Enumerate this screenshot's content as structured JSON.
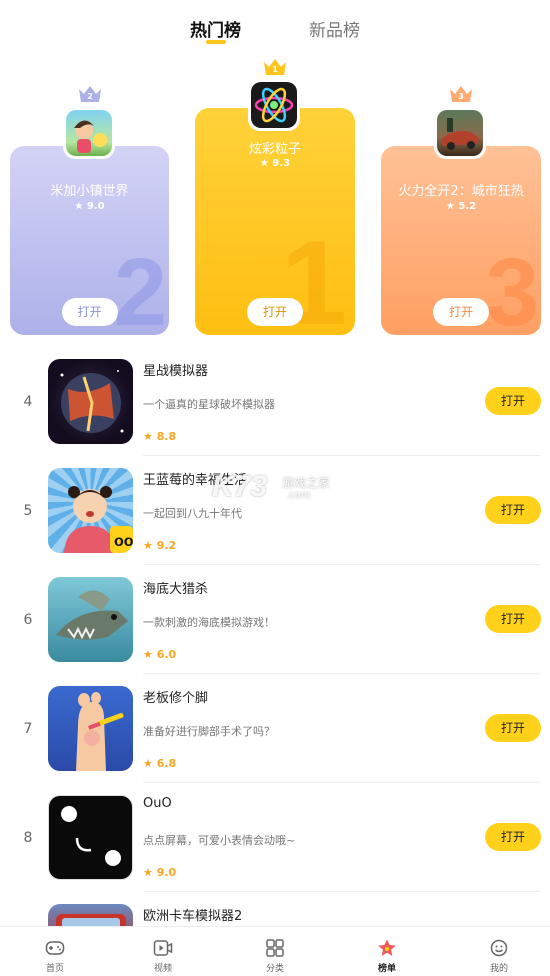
{
  "tabs": [
    {
      "label": "热门榜",
      "active": true
    },
    {
      "label": "新品榜",
      "active": false
    }
  ],
  "podium": [
    {
      "rank": "1",
      "name": "炫彩粒子",
      "rating": "9.3",
      "button": "打开",
      "color": "#ffc51a"
    },
    {
      "rank": "2",
      "name": "米加小镇世界",
      "rating": "9.0",
      "button": "打开",
      "color": "#aeb1e9"
    },
    {
      "rank": "3",
      "name": "火力全开2：城市狂热",
      "rating": "5.2",
      "button": "打开",
      "color": "#ff9f62"
    }
  ],
  "list": [
    {
      "rank": "4",
      "name": "星战模拟器",
      "desc": "一个逼真的星球破坏模拟器",
      "rating": "8.8",
      "button": "打开"
    },
    {
      "rank": "5",
      "name": "王蓝莓的幸福生活",
      "desc": "一起回到八九十年代",
      "rating": "9.2",
      "button": "打开"
    },
    {
      "rank": "6",
      "name": "海底大猎杀",
      "desc": "一款刺激的海底模拟游戏！",
      "rating": "6.0",
      "button": "打开"
    },
    {
      "rank": "7",
      "name": "老板修个脚",
      "desc": "准备好进行脚部手术了吗？",
      "rating": "6.8",
      "button": "打开"
    },
    {
      "rank": "8",
      "name": "OuO",
      "desc": "点点屏幕，可爱小表情会动哦~",
      "rating": "9.0",
      "button": "打开"
    },
    {
      "rank": "",
      "name": "欧洲卡车模拟器2",
      "desc": "",
      "rating": "",
      "button": ""
    }
  ],
  "watermark": {
    "logo": "K73",
    "subtitle": "游戏之家",
    "domain": ".com"
  },
  "nav": [
    {
      "label": "首页",
      "icon": "gamepad-icon",
      "active": false
    },
    {
      "label": "视频",
      "icon": "video-icon",
      "active": false
    },
    {
      "label": "分类",
      "icon": "grid-icon",
      "active": false
    },
    {
      "label": "榜单",
      "icon": "star-icon",
      "active": true
    },
    {
      "label": "我的",
      "icon": "smiley-icon",
      "active": false
    }
  ],
  "colors": {
    "accent": "#ffd11a",
    "rating": "#f5a623"
  }
}
